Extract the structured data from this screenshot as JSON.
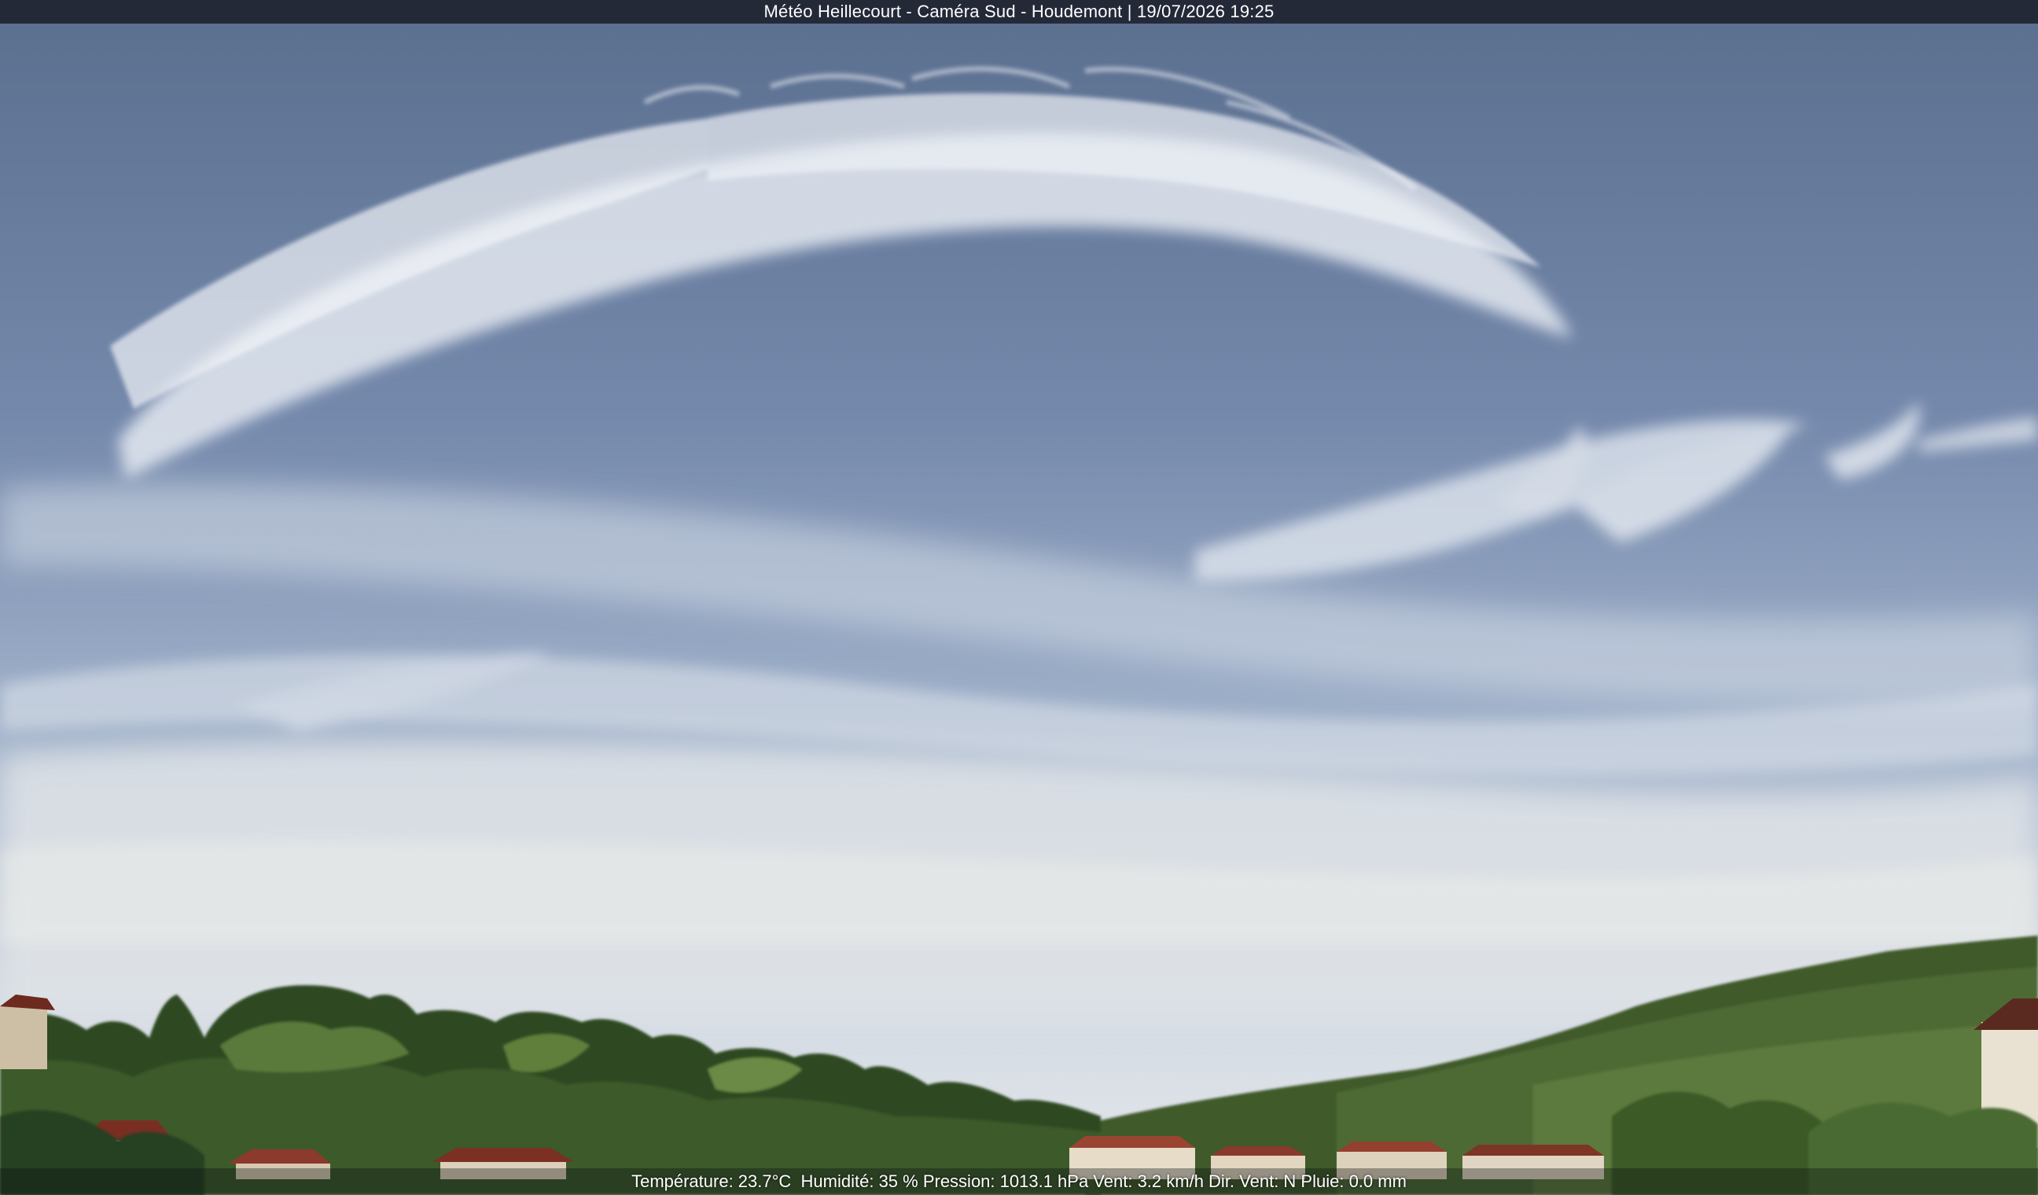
{
  "overlay": {
    "title": "Météo Heillecourt - Caméra Sud - Houdemont | 19/07/2026 19:25",
    "weather_line": "Température: 23.7°C  Humidité: 35 % Pression: 1013.1 hPa Vent: 3.2 km/h Dir. Vent: N Pluie: 0.0 mm"
  },
  "colors": {
    "sky_top": "#5f7494",
    "sky_mid": "#8497b8",
    "sky_horizon": "#d8dee6",
    "cloud": "#e9edf3",
    "foliage_dark": "#2f4a22",
    "foliage_light": "#5f7f3a",
    "roof": "#8a3a2a"
  }
}
